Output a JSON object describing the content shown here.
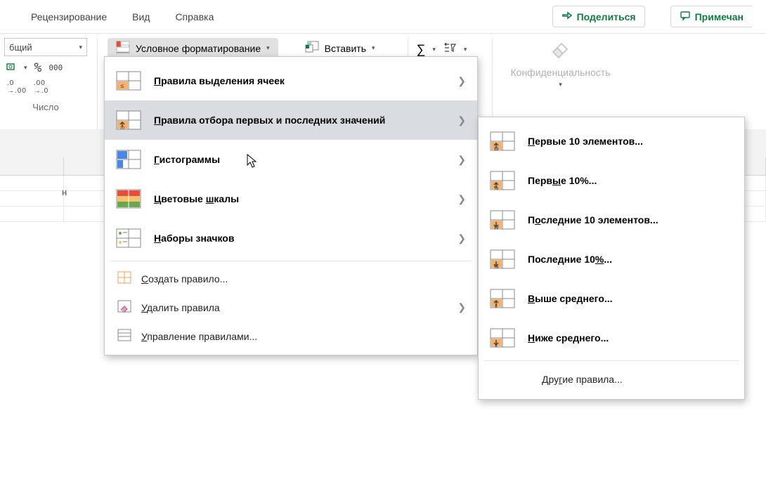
{
  "tabs": {
    "review": "Рецензирование",
    "view": "Вид",
    "help": "Справка"
  },
  "actions": {
    "share": "Поделиться",
    "comments": "Примечан"
  },
  "number_group": {
    "format_combo": "бщий",
    "caption": "Число",
    "percent_000": "000"
  },
  "ribbon": {
    "cond_format": "Условное форматирование",
    "insert": "Вставить",
    "confidentiality": "Конфиденциальность"
  },
  "menu": {
    "highlight_rules": "равила выделения ячеек",
    "highlight_prefix": "П",
    "top_bottom": "равила отбора первых и последних значений",
    "top_bottom_prefix": "П",
    "data_bars": "истограммы",
    "data_bars_prefix": "Г",
    "color_scales": "ветовые ",
    "color_scales_prefix": "Ц",
    "color_scales_mid": "ш",
    "color_scales_suffix": "калы",
    "icon_sets": "аборы значков",
    "icon_sets_prefix": "Н",
    "new_rule": "оздать правило...",
    "new_rule_prefix": "С",
    "clear_rules": "далить правила",
    "clear_rules_prefix": "У",
    "manage_rules": "правление правилами...",
    "manage_rules_prefix": "У"
  },
  "submenu": {
    "top10items_prefix": "П",
    "top10items": "ервые 10 элементов...",
    "top10pct": "Перв",
    "top10pct_u": "ы",
    "top10pct_suffix": "е 10%...",
    "bottom10items": "П",
    "bottom10items_u": "о",
    "bottom10items_suffix": "следние 10 элементов...",
    "bottom10pct": "Последние 10",
    "bottom10pct_u": "%",
    "bottom10pct_suffix": "...",
    "above_avg_prefix": "В",
    "above_avg": "ыше среднего...",
    "below_avg_prefix": "Н",
    "below_avg": "иже среднего...",
    "other": "Дру",
    "other_u": "г",
    "other_suffix": "ие правила..."
  },
  "col_header": "н"
}
